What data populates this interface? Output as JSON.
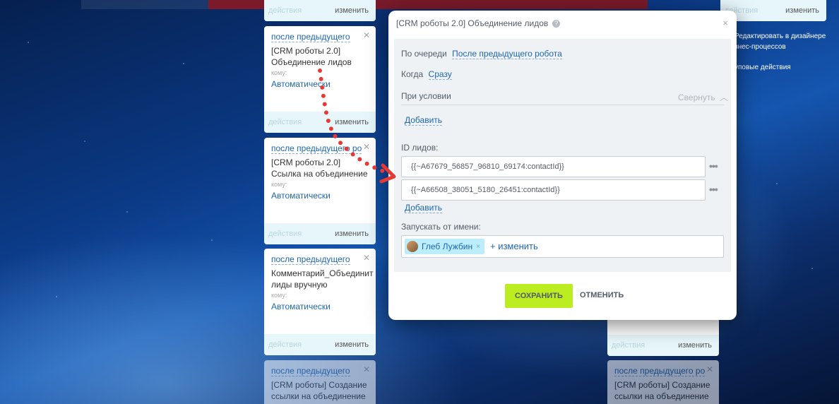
{
  "board": {
    "top_left_card": {
      "a": "действия",
      "b": "изменить"
    },
    "cards": [
      {
        "title": "после предыдущего",
        "name": "[CRM роботы 2.0] Объединение лидов",
        "who": "кому:",
        "mode": "Автоматически",
        "actions": "действия",
        "edit": "изменить"
      },
      {
        "title": "после предыдущего ро",
        "name": "[CRM роботы 2.0] Ссылка на объединение",
        "who": "кому:",
        "mode": "Автоматически",
        "actions": "действия",
        "edit": "изменить"
      },
      {
        "title": "после предыдущего",
        "name": "Комментарий_Объединит лиды вручную",
        "who": "кому:",
        "mode": "Автоматически",
        "actions": "действия",
        "edit": "изменить"
      },
      {
        "title": "после предыдущего",
        "name": "[CRM роботы] Создание ссылки на объединение",
        "who": "",
        "mode": "",
        "actions": "",
        "edit": ""
      }
    ],
    "right_card": {
      "actions": "действия",
      "edit": "изменить",
      "title": "после предыдущего ро",
      "name": "[CRM роботы] Создание ссылки на объединение"
    },
    "right_top_card": {
      "a": "действия",
      "b": "изменить"
    },
    "right_panel": [
      "Редактировать в дизайнере",
      "знес-процессов",
      "уповые действия"
    ]
  },
  "modal": {
    "title": "[CRM роботы 2.0] Объединение лидов",
    "help_icon": "?",
    "close_icon": "×",
    "order_label": "По очереди",
    "order_value": "После предыдущего робота",
    "when_label": "Когда",
    "when_value": "Сразу",
    "condition_label": "При условии",
    "collapse_label": "Свернуть",
    "add_condition": "Добавить",
    "ids_label": "ID лидов:",
    "ids": [
      "{{~A67679_56857_96810_69174:contactId}}",
      "{{~A66508_38051_5180_26451:contactId}}"
    ],
    "dots": "•••",
    "add_id": "Добавить",
    "run_as_label": "Запускать от имени:",
    "user_name": "Глеб Лужбин",
    "chip_remove": "×",
    "change_user": "+ изменить",
    "save": "СОХРАНИТЬ",
    "cancel": "ОТМЕНИТЬ"
  }
}
